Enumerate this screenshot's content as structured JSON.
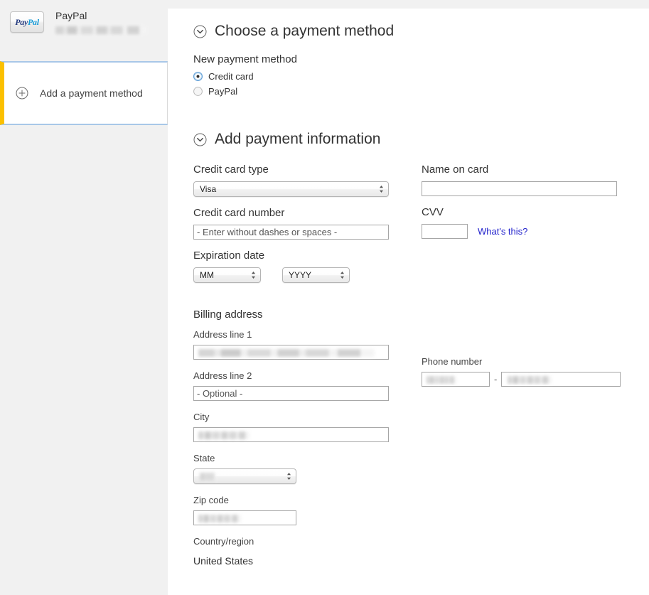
{
  "sidebar": {
    "saved_method": {
      "logo_text_a": "Pay",
      "logo_text_b": "Pal",
      "title": "PayPal",
      "detail_redacted": true
    },
    "add_method": {
      "label": "Add a payment method",
      "icon": "plus-circle-icon",
      "selected": true,
      "accent_color": "#fbc000",
      "focus_border_color": "#a8c7e8"
    }
  },
  "main": {
    "choose_section": {
      "title": "Choose a payment method",
      "toggle_icon": "chevron-down-circle-icon",
      "subhead": "New payment method",
      "options": [
        {
          "label": "Credit card",
          "selected": true
        },
        {
          "label": "PayPal",
          "selected": false
        }
      ]
    },
    "add_section": {
      "title": "Add payment information",
      "toggle_icon": "chevron-down-circle-icon",
      "fields": {
        "credit_card_type": {
          "label": "Credit card type",
          "value": "Visa"
        },
        "credit_card_number": {
          "label": "Credit card number",
          "placeholder": "- Enter without dashes or spaces -",
          "value": ""
        },
        "expiration": {
          "label": "Expiration date",
          "month_value": "MM",
          "year_value": "YYYY"
        },
        "name_on_card": {
          "label": "Name on card",
          "value": ""
        },
        "cvv": {
          "label": "CVV",
          "value": "",
          "help_link": "What's this?"
        }
      },
      "billing": {
        "heading": "Billing address",
        "address_line_1": {
          "label": "Address line 1",
          "value_redacted": true
        },
        "address_line_2": {
          "label": "Address line 2",
          "placeholder": "- Optional -",
          "value": ""
        },
        "city": {
          "label": "City",
          "value_redacted": true
        },
        "state": {
          "label": "State",
          "value_redacted": true
        },
        "zip": {
          "label": "Zip code",
          "value_redacted": true
        },
        "country": {
          "label": "Country/region",
          "value": "United States"
        },
        "phone": {
          "label": "Phone number",
          "area_redacted": true,
          "number_redacted": true,
          "separator": "-"
        }
      }
    }
  },
  "colors": {
    "page_background": "#f1f1f1",
    "panel_background": "#ffffff",
    "link": "#2222cc",
    "selection_accent": "#fbc000",
    "selection_border": "#a8c7e8",
    "radio_selected": "#5b9bd5"
  }
}
